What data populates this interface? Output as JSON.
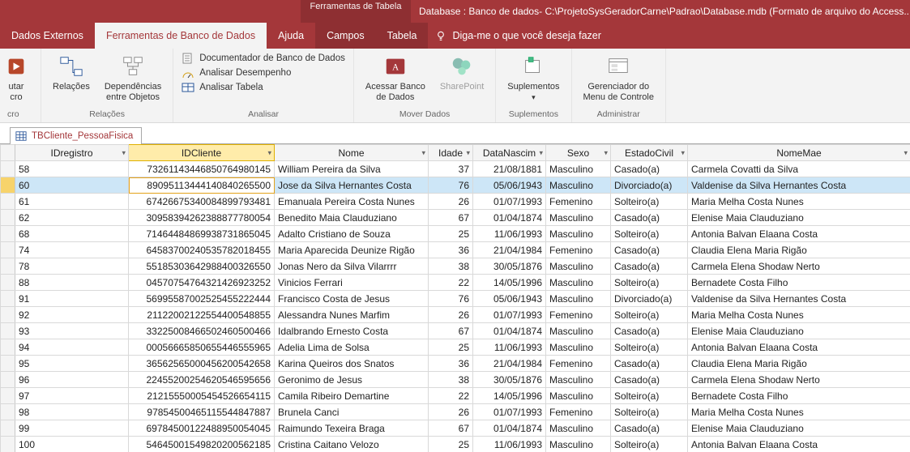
{
  "title": {
    "tool_tab_group": "Ferramentas de Tabela",
    "tool_tab_campos": "Campos",
    "tool_tab_tabela": "Tabela",
    "db_label": "Database : Banco de dados- C:\\ProjetoSysGeradorCarne\\Padrao\\Database.mdb (Formato de arquivo do Access..."
  },
  "tabs": {
    "t0": "Dados Externos",
    "t1": "Ferramentas de Banco de Dados",
    "t2": "Ajuda",
    "t3": "Campos",
    "t4": "Tabela",
    "tell_me": "Diga-me o que você deseja fazer"
  },
  "ribbon": {
    "g0_lbl": "cro",
    "g0_btn0": "utar\ncro",
    "g1_lbl": "Relações",
    "g1_btn0": "Relações",
    "g1_btn1": "Dependências\nentre Objetos",
    "g2_lbl": "Analisar",
    "g2_row0": "Documentador de Banco de Dados",
    "g2_row1": "Analisar Desempenho",
    "g2_row2": "Analisar Tabela",
    "g3_lbl": "Mover Dados",
    "g3_btn0": "Acessar Banco\nde Dados",
    "g3_btn1": "SharePoint",
    "g4_lbl": "Suplementos",
    "g4_btn0": "Suplementos",
    "g5_lbl": "Administrar",
    "g5_btn0": "Gerenciador do\nMenu de Controle"
  },
  "doctab": "TBCliente_PessoaFisica",
  "columns": {
    "c0": "IDregistro",
    "c1": "IDCliente",
    "c2": "Nome",
    "c3": "Idade",
    "c4": "DataNascim",
    "c5": "Sexo",
    "c6": "EstadoCivil",
    "c7": "NomeMae"
  },
  "rows": [
    {
      "id": "58",
      "cli": "7326114344685076498014",
      "cli5": "73261143446850764980145",
      "nome": "William Pereira da Silva",
      "idade": "37",
      "data": "21/08/1881",
      "sexo": "Masculino",
      "est": "Casado(a)",
      "mae": "Carmela Covatti  da Silva"
    },
    {
      "id": "60",
      "cli": "8909511344414084026550",
      "cli5": "89095113444140840265500",
      "nome": "Jose da Silva Hernantes Costa",
      "idade": "76",
      "data": "05/06/1943",
      "sexo": "Masculino",
      "est": "Divorciado(a)",
      "mae": "Valdenise da Silva Hernantes Costa",
      "selected": true
    },
    {
      "id": "61",
      "cli": "6742667534008489979348",
      "cli5": "67426675340084899793481",
      "nome": "Emanuala Pereira Costa Nunes",
      "idade": "26",
      "data": "01/07/1993",
      "sexo": "Femenino",
      "est": "Solteiro(a)",
      "mae": "Maria Melha Costa Nunes"
    },
    {
      "id": "62",
      "cli": "3095839426238887778005",
      "cli5": "30958394262388877780054",
      "nome": "Benedito Maia Clauduziano",
      "idade": "67",
      "data": "01/04/1874",
      "sexo": "Masculino",
      "est": "Casado(a)",
      "mae": "Elenise Maia Clauduziano"
    },
    {
      "id": "68",
      "cli": "7146448486993873186504",
      "cli5": "71464484869938731865045",
      "nome": "Adalto Cristiano de Souza",
      "idade": "25",
      "data": "11/06/1993",
      "sexo": "Masculino",
      "est": "Solteiro(a)",
      "mae": "Antonia Balvan Elaana Costa"
    },
    {
      "id": "74",
      "cli": "6458370024053578201845",
      "cli5": "64583700240535782018455",
      "nome": "Maria Aparecida Deunize Rigão",
      "idade": "36",
      "data": "21/04/1984",
      "sexo": "Femenino",
      "est": "Casado(a)",
      "mae": "Claudia Elena Maria Rigão"
    },
    {
      "id": "78",
      "cli": "5518530364298840032655",
      "cli5": "55185303642988400326550",
      "nome": "Jonas Nero da Silva Vilarrrr",
      "idade": "38",
      "data": "30/05/1876",
      "sexo": "Masculino",
      "est": "Casado(a)",
      "mae": "Carmela Elena Shodaw Nerto"
    },
    {
      "id": "88",
      "cli": "0457075476432142692325",
      "cli5": "04570754764321426923252",
      "nome": "Vinicios Ferrari",
      "idade": "22",
      "data": "14/05/1996",
      "sexo": "Masculino",
      "est": "Solteiro(a)",
      "mae": "Bernadete Costa Filho"
    },
    {
      "id": "91",
      "cli": "5699558700252545522244",
      "cli5": "56995587002525455222444",
      "nome": "Francisco Costa de Jesus",
      "idade": "76",
      "data": "05/06/1943",
      "sexo": "Masculino",
      "est": "Divorciado(a)",
      "mae": "Valdenise da Silva Hernantes Costa"
    },
    {
      "id": "92",
      "cli": "2112200212255440054885",
      "cli5": "21122002122554400548855",
      "nome": "Alessandra Nunes Marfim",
      "idade": "26",
      "data": "01/07/1993",
      "sexo": "Femenino",
      "est": "Solteiro(a)",
      "mae": "Maria Melha Costa Nunes"
    },
    {
      "id": "93",
      "cli": "3322500846650246050046",
      "cli5": "33225008466502460500466",
      "nome": "Idalbrando Ernesto Costa",
      "idade": "67",
      "data": "01/04/1874",
      "sexo": "Masculino",
      "est": "Casado(a)",
      "mae": "Elenise Maia Clauduziano"
    },
    {
      "id": "94",
      "cli": "0005666585065544655596",
      "cli5": "00056665850655446555965",
      "nome": "Adelia Lima de Solsa",
      "idade": "25",
      "data": "11/06/1993",
      "sexo": "Masculino",
      "est": "Solteiro(a)",
      "mae": "Antonia Balvan Elaana Costa"
    },
    {
      "id": "95",
      "cli": "3656256500045620054265",
      "cli5": "36562565000456200542658",
      "nome": "Karina Queiros dos Snatos",
      "idade": "36",
      "data": "21/04/1984",
      "sexo": "Femenino",
      "est": "Casado(a)",
      "mae": "Claudia Elena Maria Rigão"
    },
    {
      "id": "96",
      "cli": "2245520025462054659565",
      "cli5": "22455200254620546595656",
      "nome": "Geronimo de Jesus",
      "idade": "38",
      "data": "30/05/1876",
      "sexo": "Masculino",
      "est": "Casado(a)",
      "mae": "Carmela Elena Shodaw Nerto"
    },
    {
      "id": "97",
      "cli": "2121555000545452665411",
      "cli5": "21215550005454526654115",
      "nome": "Camila Ribeiro Demartine",
      "idade": "22",
      "data": "14/05/1996",
      "sexo": "Masculino",
      "est": "Solteiro(a)",
      "mae": "Bernadete Costa Filho"
    },
    {
      "id": "98",
      "cli": "9785450046511554484788",
      "cli5": "97854500465115544847887",
      "nome": "Brunela Canci",
      "idade": "26",
      "data": "01/07/1993",
      "sexo": "Femenino",
      "est": "Solteiro(a)",
      "mae": "Maria Melha Costa Nunes"
    },
    {
      "id": "99",
      "cli": "6978450012248895005404",
      "cli5": "69784500122488950054045",
      "nome": "Raimundo Texeira Braga",
      "idade": "67",
      "data": "01/04/1874",
      "sexo": "Masculino",
      "est": "Casado(a)",
      "mae": "Elenise Maia Clauduziano"
    },
    {
      "id": "100",
      "cli": "5464500154982020056218",
      "cli5": "54645001549820200562185",
      "nome": "Cristina Caitano Velozo",
      "idade": "25",
      "data": "11/06/1993",
      "sexo": "Masculino",
      "est": "Solteiro(a)",
      "mae": "Antonia Balvan Elaana Costa"
    }
  ]
}
